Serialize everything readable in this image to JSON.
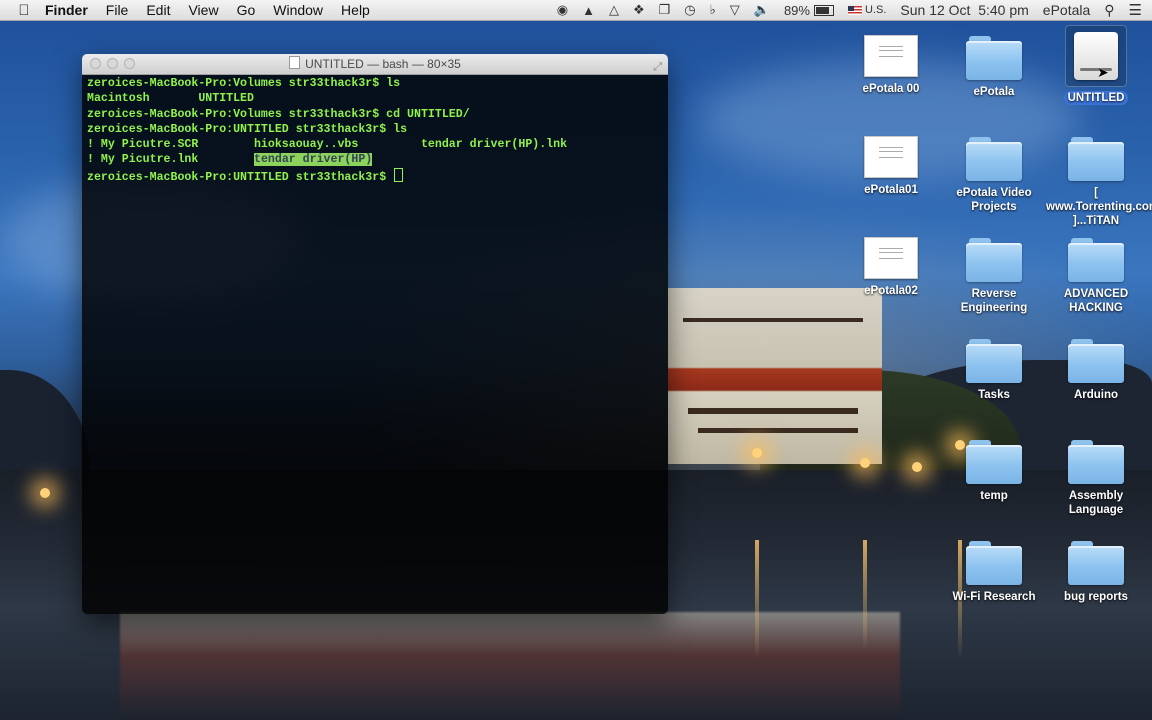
{
  "menubar": {
    "app": "Finder",
    "items": [
      "File",
      "Edit",
      "View",
      "Go",
      "Window",
      "Help"
    ],
    "status": {
      "battery": "89%",
      "input_source": "U.S.",
      "clock": "Sun 12 Oct  5:40 pm",
      "user": "ePotala"
    }
  },
  "terminal": {
    "title": "UNTITLED — bash — 80×35",
    "lines": [
      "zeroices-MacBook-Pro:Volumes str33thack3r$ ls",
      "Macintosh       UNTITLED",
      "zeroices-MacBook-Pro:Volumes str33thack3r$ cd UNTITLED/",
      "zeroices-MacBook-Pro:UNTITLED str33thack3r$ ls",
      "! My Picutre.SCR        hioksaouay..vbs         tendar driver(HP).lnk",
      "! My Picutre.lnk        ",
      "zeroices-MacBook-Pro:UNTITLED str33thack3r$ "
    ],
    "highlighted": "tendar driver(HP)"
  },
  "desktop": {
    "icons": [
      {
        "label": "ePotala 00",
        "type": "document"
      },
      {
        "label": "ePotala",
        "type": "folder"
      },
      {
        "label": "UNTITLED",
        "type": "drive"
      },
      {
        "label": "ePotala01",
        "type": "document"
      },
      {
        "label": "ePotala Video Projects",
        "type": "folder"
      },
      {
        "label": "[ www.Torrenting.com ]...TiTAN",
        "type": "folder"
      },
      {
        "label": "ePotala02",
        "type": "document"
      },
      {
        "label": "Reverse Engineering",
        "type": "folder"
      },
      {
        "label": "ADVANCED HACKING",
        "type": "folder"
      },
      {
        "label": "Tasks",
        "type": "folder"
      },
      {
        "label": "Arduino",
        "type": "folder"
      },
      {
        "label": "temp",
        "type": "folder"
      },
      {
        "label": "Assembly Language",
        "type": "folder"
      },
      {
        "label": "Wi-Fi Research",
        "type": "folder"
      },
      {
        "label": "bug reports",
        "type": "folder"
      }
    ]
  }
}
